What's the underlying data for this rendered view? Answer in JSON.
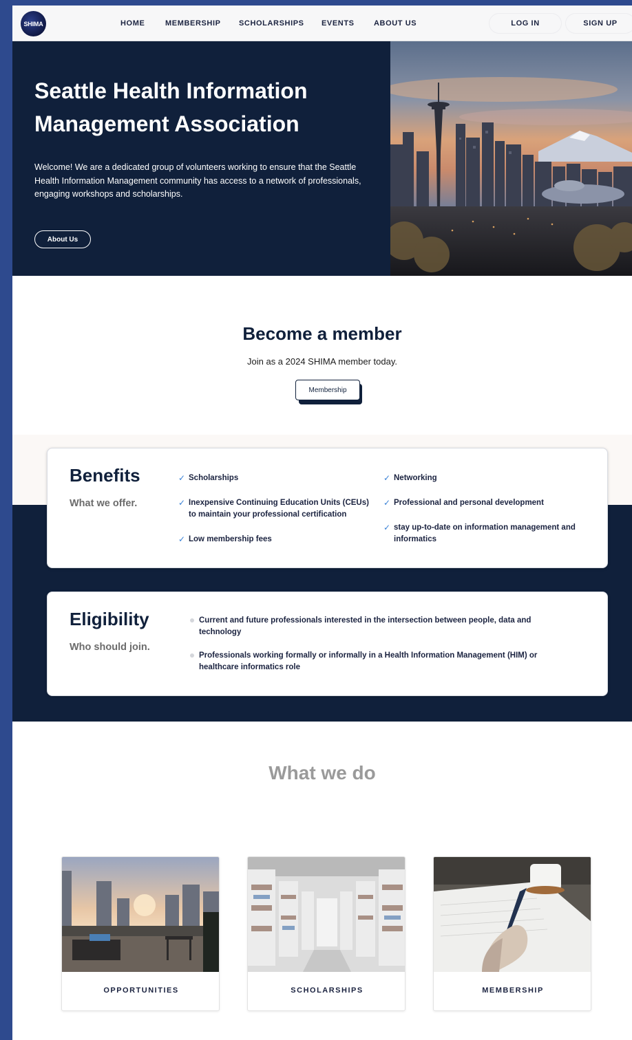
{
  "logo": {
    "text": "SHIMA"
  },
  "nav": {
    "links": [
      "HOME",
      "MEMBERSHIP",
      "SCHOLARSHIPS",
      "EVENTS",
      "ABOUT US"
    ],
    "login": "LOG IN",
    "signup": "SIGN UP"
  },
  "hero": {
    "title_line1": "Seattle Health Information",
    "title_line2": "Management Association",
    "text": "Welcome! We are a dedicated group of volunteers working to ensure that the Seattle Health Information Management community has access to a network of professionals, engaging workshops and scholarships.",
    "button": "About Us"
  },
  "member": {
    "title": "Become a member",
    "subtitle": "Join as a 2024 SHIMA member today.",
    "button": "Membership"
  },
  "benefits": {
    "title": "Benefits",
    "subtitle": "What we offer.",
    "left": [
      "Scholarships",
      "Inexpensive Continuing Education Units (CEUs) to maintain your professional certification",
      "Low membership fees"
    ],
    "right": [
      "Networking",
      "Professional and personal development",
      "stay up-to-date on information management and informatics"
    ]
  },
  "eligibility": {
    "title": "Eligibility",
    "subtitle": "Who should join.",
    "items": [
      "Current and future professionals interested in the intersection between people, data and technology",
      "Professionals working formally or informally in a Health Information Management (HIM) or healthcare informatics role"
    ]
  },
  "what_we_do": {
    "title": "What we do",
    "tiles": [
      "OPPORTUNITIES",
      "SCHOLARSHIPS",
      "MEMBERSHIP"
    ]
  },
  "colors": {
    "navy": "#10203b",
    "frame": "#2e4a8e",
    "check": "#3b82d6"
  }
}
